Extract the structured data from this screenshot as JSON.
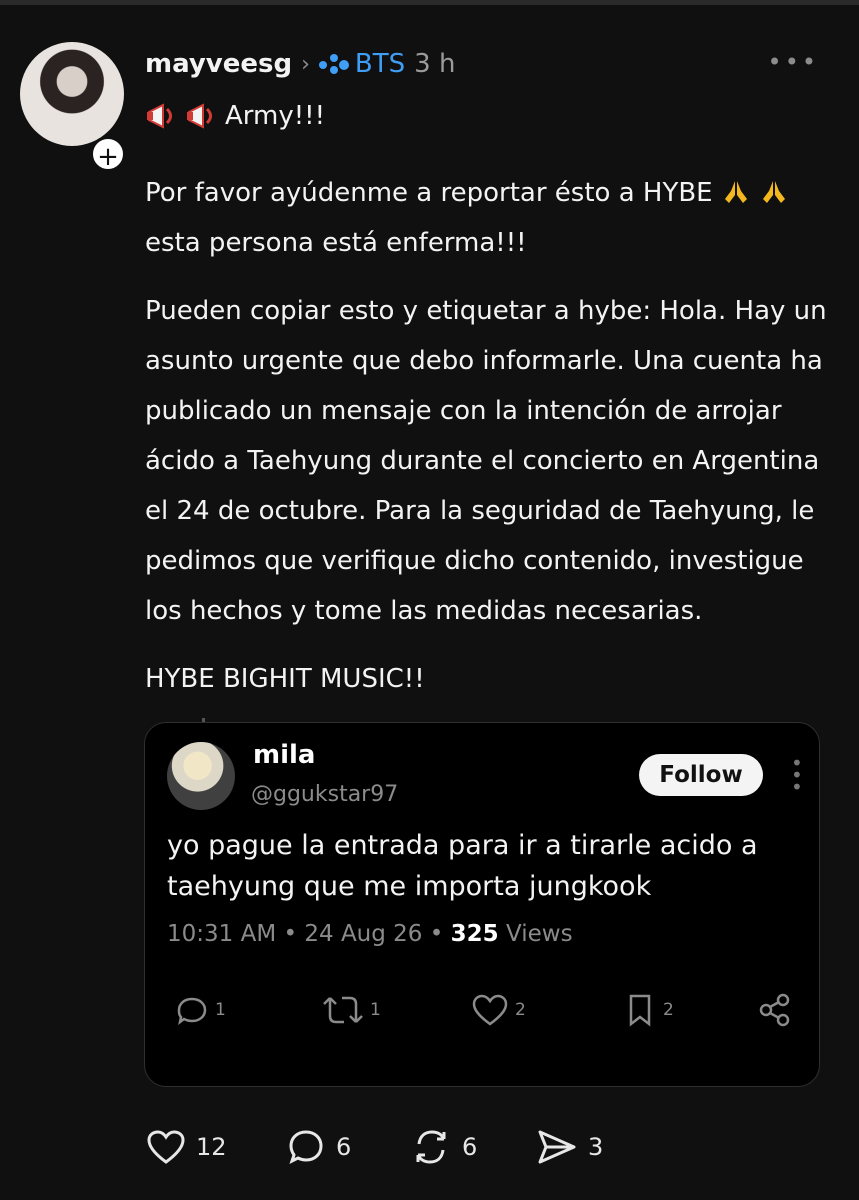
{
  "post": {
    "username": "mayveesg",
    "community": "BTS",
    "time": "3 h",
    "headline": "Army!!!",
    "paragraph1_a": "Por favor ayúdenme a reportar ésto a HYBE",
    "paragraph1_b": "esta persona está enferma!!!",
    "paragraph2": "Pueden copiar esto y etiquetar a hybe: Hola. Hay un asunto urgente que debo informarle. Una cuenta ha publicado un mensaje con la intención de arrojar ácido a Taehyung durante el concierto en Argentina el 24 de octubre. Para la seguridad de Taehyung, le pedimos que verifique dicho contenido, investigue los hechos y tome las medidas necesarias.",
    "paragraph3": "HYBE BIGHIT MUSIC!!",
    "likes": "12",
    "comments": "6",
    "reposts": "6",
    "shares": "3"
  },
  "quoted": {
    "name": "mila",
    "handle": "@ggukstar97",
    "follow_label": "Follow",
    "text": "yo pague la entrada para ir a tirarle acido a taehyung que me importa jungkook",
    "time": "10:31 AM",
    "date": "24 Aug 26",
    "views_count": "325",
    "views_label": "Views",
    "replies": "1",
    "retweets": "1",
    "likes": "2",
    "bookmarks": "2"
  },
  "icons": {
    "avatar_badge": "plus-icon",
    "community": "community-dots-icon",
    "more": "more-icon",
    "megaphone": "megaphone-icon",
    "pray": "praying-hands-icon"
  },
  "colors": {
    "background": "#101010",
    "accent": "#3f9ef5",
    "muted": "#8b8b8b"
  }
}
